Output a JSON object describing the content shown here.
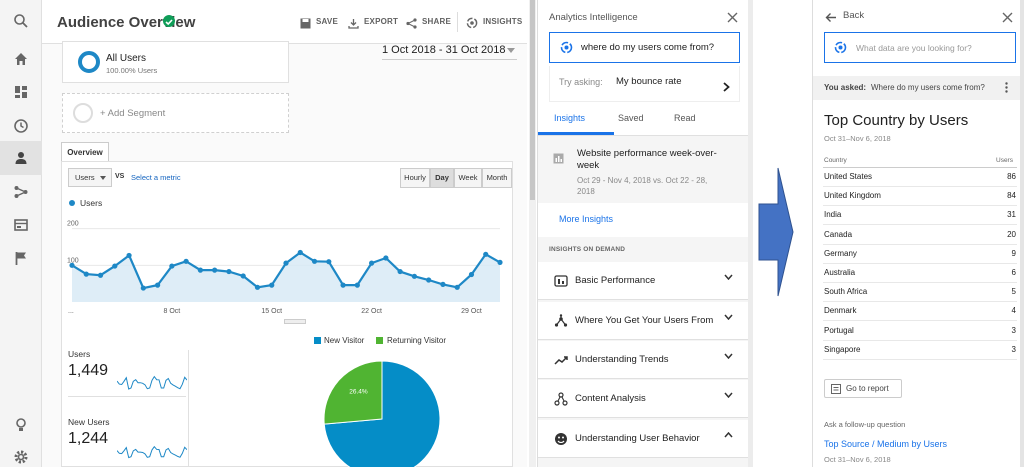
{
  "report": {
    "title": "Audience Overview",
    "actions": {
      "save": "SAVE",
      "export": "EXPORT",
      "share": "SHARE",
      "insights": "INSIGHTS"
    },
    "segment": {
      "name": "All Users",
      "pct": "100.00% Users",
      "add": "+ Add Segment"
    },
    "date_range": "1 Oct 2018 - 31 Oct 2018",
    "overview_tab": "Overview",
    "metric_select": "Users",
    "vs": "VS",
    "select_metric": "Select a metric",
    "granularity": [
      "Hourly",
      "Day",
      "Week",
      "Month"
    ],
    "legend_users": "Users",
    "stats": [
      {
        "label": "Users",
        "value": "1,449"
      },
      {
        "label": "New Users",
        "value": "1,244"
      }
    ],
    "pie_legend": {
      "new": "New Visitor",
      "returning": "Returning Visitor"
    },
    "colors": {
      "accent": "#1e88c6",
      "green": "#50b432",
      "pie_blue": "#058dc7"
    }
  },
  "chart_data": [
    {
      "type": "line",
      "x": [
        "1 Oct",
        "2 Oct",
        "3 Oct",
        "4 Oct",
        "5 Oct",
        "6 Oct",
        "7 Oct",
        "8 Oct",
        "9 Oct",
        "10 Oct",
        "11 Oct",
        "12 Oct",
        "13 Oct",
        "14 Oct",
        "15 Oct",
        "16 Oct",
        "17 Oct",
        "18 Oct",
        "19 Oct",
        "20 Oct",
        "21 Oct",
        "22 Oct",
        "23 Oct",
        "24 Oct",
        "25 Oct",
        "26 Oct",
        "27 Oct",
        "28 Oct",
        "29 Oct",
        "30 Oct",
        "31 Oct"
      ],
      "series": [
        {
          "name": "Users",
          "values": [
            100,
            76,
            73,
            98,
            127,
            38,
            46,
            98,
            111,
            87,
            87,
            83,
            71,
            40,
            46,
            106,
            135,
            111,
            110,
            46,
            46,
            106,
            120,
            83,
            70,
            60,
            48,
            40,
            75,
            130,
            108
          ]
        }
      ],
      "xtick_labels": [
        "...",
        "8 Oct",
        "15 Oct",
        "22 Oct",
        "29 Oct"
      ],
      "ytick_labels": [
        "100",
        "200"
      ],
      "ylim": [
        0,
        240
      ]
    },
    {
      "type": "pie",
      "categories": [
        "New Visitor",
        "Returning Visitor"
      ],
      "values": [
        73.6,
        26.4
      ],
      "labels": [
        "73.6%",
        "26.4%"
      ]
    }
  ],
  "intel": {
    "title": "Analytics Intelligence",
    "query": "where do my users come from?",
    "try_prefix": "Try asking:",
    "try_query": "My bounce rate",
    "tabs": [
      "Insights",
      "Saved",
      "Read"
    ],
    "insight_title": "Website performance week-over-week",
    "insight_dates": "Oct 29 - Nov 4, 2018 vs. Oct 22 - 28, 2018",
    "more_insights": "More Insights",
    "on_demand": "INSIGHTS ON DEMAND",
    "sections": [
      "Basic Performance",
      "Where You Get Your Users From",
      "Understanding Trends",
      "Content Analysis",
      "Understanding User Behavior"
    ]
  },
  "result": {
    "back": "Back",
    "search_placeholder": "What data are you looking for?",
    "you_asked_label": "You asked:",
    "you_asked_query": "Where do my users come from?",
    "heading": "Top Country by Users",
    "date": "Oct 31–Nov 6, 2018",
    "col_country": "Country",
    "col_users": "Users",
    "rows": [
      {
        "country": "United States",
        "users": "86"
      },
      {
        "country": "United Kingdom",
        "users": "84"
      },
      {
        "country": "India",
        "users": "31"
      },
      {
        "country": "Canada",
        "users": "20"
      },
      {
        "country": "Germany",
        "users": "9"
      },
      {
        "country": "Australia",
        "users": "6"
      },
      {
        "country": "South Africa",
        "users": "5"
      },
      {
        "country": "Denmark",
        "users": "4"
      },
      {
        "country": "Portugal",
        "users": "3"
      },
      {
        "country": "Singapore",
        "users": "3"
      }
    ],
    "go_to_report": "Go to report",
    "follow_up_label": "Ask a follow-up question",
    "follow_up_link": "Top Source / Medium by Users",
    "follow_up_date": "Oct 31–Nov 6, 2018"
  }
}
